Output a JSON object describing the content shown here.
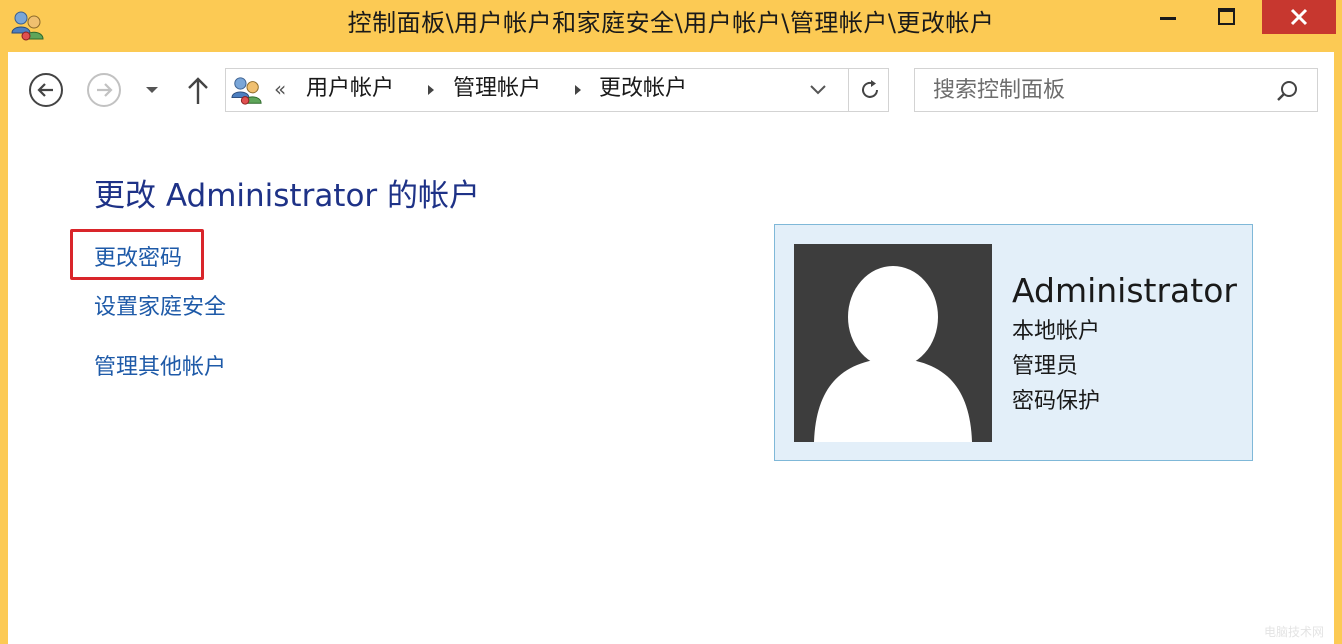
{
  "window": {
    "title": "控制面板\\用户帐户和家庭安全\\用户帐户\\管理帐户\\更改帐户",
    "accent_color": "#fcca54",
    "close_button_color": "#c7372f"
  },
  "nav": {
    "back_icon": "arrow-left-icon",
    "forward_icon": "arrow-right-icon",
    "recent_icon": "chevron-down-icon",
    "up_icon": "arrow-up-icon"
  },
  "address_bar": {
    "overflow": "«",
    "crumbs": [
      "用户帐户",
      "管理帐户",
      "更改帐户"
    ]
  },
  "search": {
    "placeholder": "搜索控制面板"
  },
  "main": {
    "heading": "更改 Administrator 的帐户",
    "heading_color": "#1e3287",
    "link_color": "#1e5aa8",
    "links": [
      {
        "label": "更改密码",
        "highlighted": true
      },
      {
        "label": "设置家庭安全"
      },
      {
        "label": "管理其他帐户"
      }
    ],
    "highlight_color": "#d9252a"
  },
  "account": {
    "name": "Administrator",
    "type": "本地帐户",
    "role": "管理员",
    "protection": "密码保护",
    "tile_color": "#e3eff9"
  },
  "watermark": "电脑技术网"
}
